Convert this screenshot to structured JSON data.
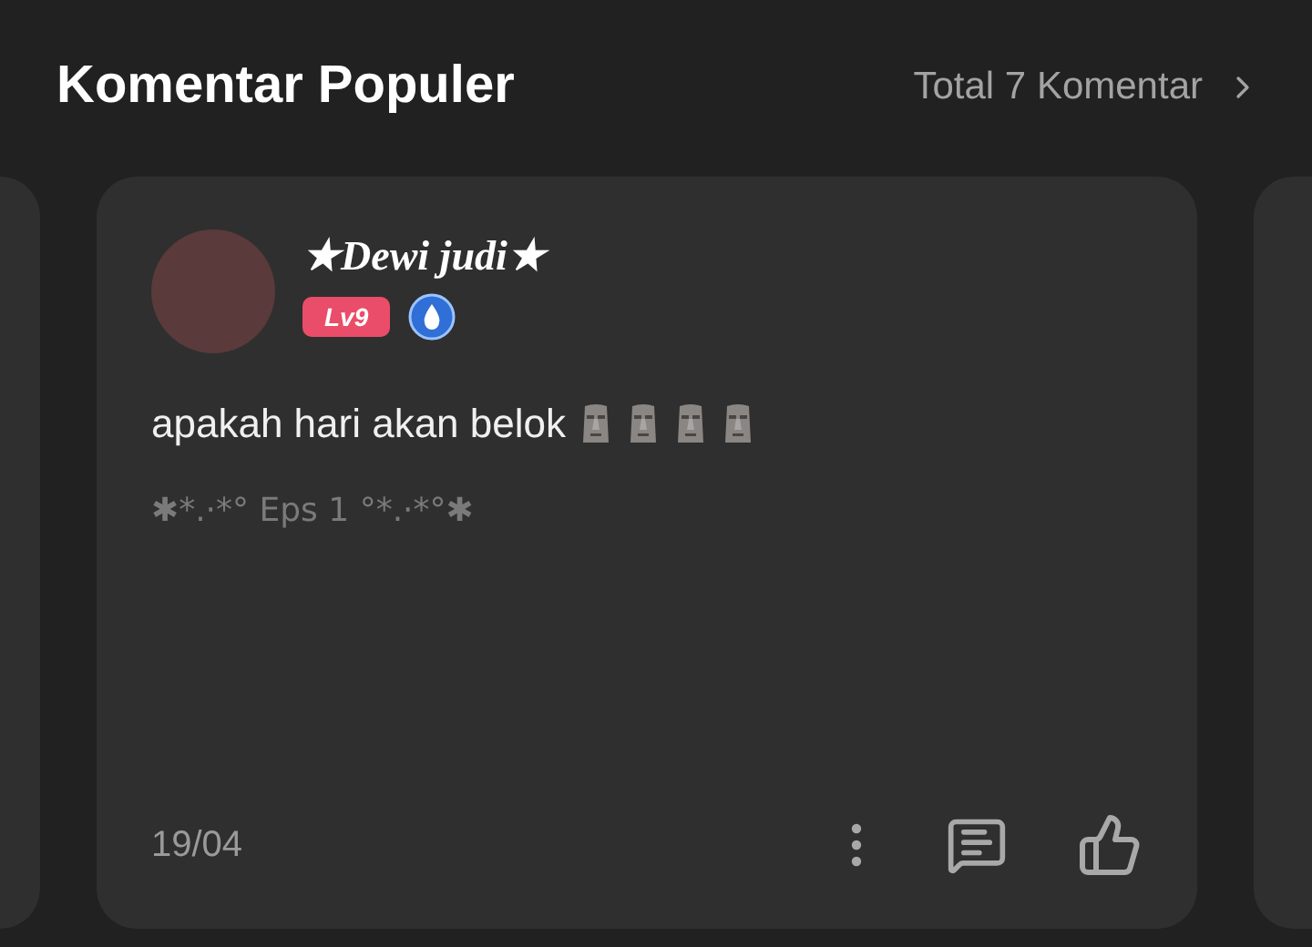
{
  "header": {
    "title": "Komentar Populer",
    "total": "Total 7 Komentar"
  },
  "comment": {
    "user": "★Dewi judi★",
    "level": "Lv9",
    "text": "apakah hari akan belok",
    "emojis": [
      {
        "kind": "moai"
      },
      {
        "kind": "moai"
      },
      {
        "kind": "moai"
      },
      {
        "kind": "moai"
      }
    ],
    "episode": "✱*.·*° Eps 1 °*.·*°✱",
    "date": "19/04"
  }
}
